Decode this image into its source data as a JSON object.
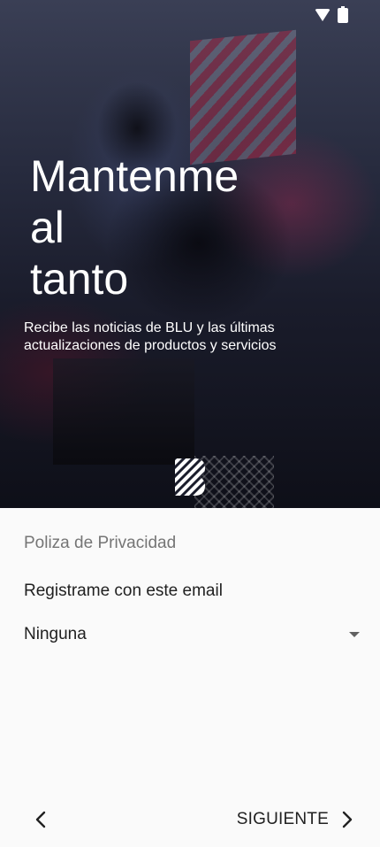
{
  "status_bar": {
    "wifi_icon": "wifi-icon",
    "battery_icon": "battery-icon"
  },
  "hero": {
    "title_lines": [
      "Mantenme",
      "al",
      "tanto"
    ],
    "description": "Recibe las noticias de BLU y las últimas actualizaciones de productos y servicios",
    "logo_icon": "blu-logo-icon"
  },
  "form": {
    "section_title": "Poliza de Privacidad",
    "email_label": "Registrame con este email",
    "email_dropdown": {
      "selected": "Ninguna",
      "arrow_icon": "dropdown-arrow-icon"
    }
  },
  "navigation": {
    "back_icon": "chevron-left-icon",
    "next_label": "SIGUIENTE",
    "next_icon": "chevron-right-icon"
  },
  "colors": {
    "background": "#fafafa",
    "text_primary": "#212121",
    "text_secondary": "#757575",
    "hero_text": "#ffffff"
  }
}
